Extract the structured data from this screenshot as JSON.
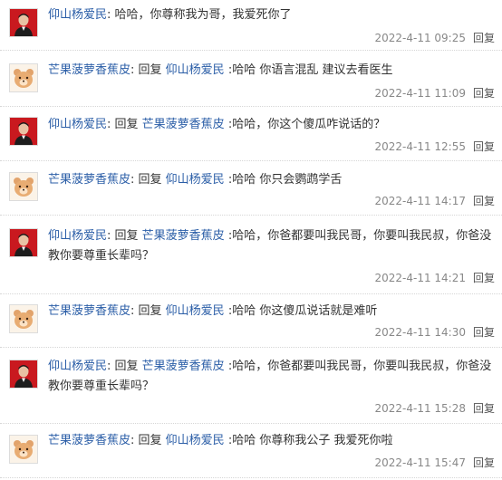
{
  "colors": {
    "link": "#2b5ea7",
    "text": "#333333",
    "meta": "#888888"
  },
  "reply_word": "回复",
  "comments": [
    {
      "author": "仰山杨爱民",
      "avatar": "man-portrait-icon",
      "prefix": "",
      "target": "",
      "text": ": 哈哈，你尊称我为哥，我爱死你了",
      "time": "2022-4-11 09:25",
      "reply_label": "回复"
    },
    {
      "author": "芒果菠萝香蕉皮",
      "avatar": "bear-icon",
      "prefix": ": 回复 ",
      "target": "仰山杨爱民",
      "text": " :哈哈 你语言混乱 建议去看医生",
      "time": "2022-4-11 11:09",
      "reply_label": "回复"
    },
    {
      "author": "仰山杨爱民",
      "avatar": "man-portrait-icon",
      "prefix": ": 回复 ",
      "target": "芒果菠萝香蕉皮",
      "text": " :哈哈，你这个傻瓜咋说话的？",
      "time": "2022-4-11 12:55",
      "reply_label": "回复"
    },
    {
      "author": "芒果菠萝香蕉皮",
      "avatar": "bear-icon",
      "prefix": ": 回复 ",
      "target": "仰山杨爱民",
      "text": " :哈哈 你只会鹦鹉学舌",
      "time": "2022-4-11 14:17",
      "reply_label": "回复"
    },
    {
      "author": "仰山杨爱民",
      "avatar": "man-portrait-icon",
      "prefix": ": 回复 ",
      "target": "芒果菠萝香蕉皮",
      "text": " :哈哈，你爸都要叫我民哥，你要叫我民叔，你爸没教你要尊重长辈吗？",
      "time": "2022-4-11 14:21",
      "reply_label": "回复"
    },
    {
      "author": "芒果菠萝香蕉皮",
      "avatar": "bear-icon",
      "prefix": ": 回复 ",
      "target": "仰山杨爱民",
      "text": " :哈哈 你这傻瓜说话就是难听",
      "time": "2022-4-11 14:30",
      "reply_label": "回复"
    },
    {
      "author": "仰山杨爱民",
      "avatar": "man-portrait-icon",
      "prefix": ": 回复 ",
      "target": "芒果菠萝香蕉皮",
      "text": " :哈哈，你爸都要叫我民哥，你要叫我民叔，你爸没教你要尊重长辈吗？",
      "time": "2022-4-11 15:28",
      "reply_label": "回复"
    },
    {
      "author": "芒果菠萝香蕉皮",
      "avatar": "bear-icon",
      "prefix": ": 回复 ",
      "target": "仰山杨爱民",
      "text": " :哈哈 你尊称我公子 我爱死你啦",
      "time": "2022-4-11 15:47",
      "reply_label": "回复"
    }
  ]
}
